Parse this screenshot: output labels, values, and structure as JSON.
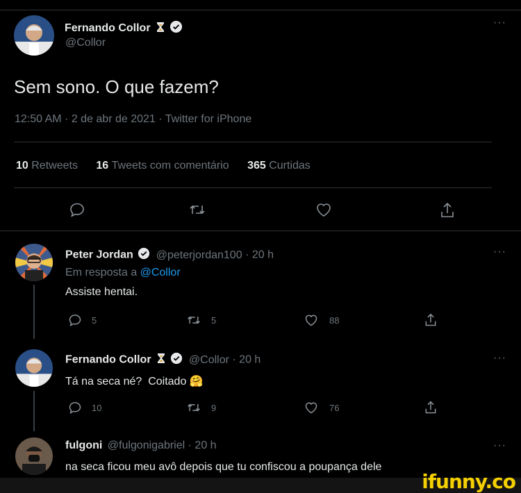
{
  "main_tweet": {
    "author_name": "Fernando Collor",
    "author_handle": "@Collor",
    "text": "Sem sono. O que fazem?",
    "meta": "12:50 AM · 2 de abr de 2021 · Twitter for iPhone",
    "stats": [
      {
        "num": "10",
        "label": "Retweets"
      },
      {
        "num": "16",
        "label": "Tweets com comentário"
      },
      {
        "num": "365",
        "label": "Curtidas"
      }
    ],
    "more_icon": "ellipsis-icon"
  },
  "replies": [
    {
      "author_name": "Peter Jordan",
      "author_handle": "@peterjordan100",
      "time": "· 20 h",
      "reply_prefix": "Em resposta a",
      "reply_to": "@Collor",
      "text": "Assiste hentai.",
      "reply_count": "5",
      "retweet_count": "5",
      "like_count": "88"
    },
    {
      "author_name": "Fernando Collor",
      "author_handle": "@Collor",
      "time": "· 20 h",
      "text": "Tá na seca né?  Coitado",
      "emoji": "🤗",
      "reply_count": "10",
      "retweet_count": "9",
      "like_count": "76"
    },
    {
      "author_name": "fulgoni",
      "author_handle": "@fulgonigabriel",
      "time": "· 20 h",
      "text": "na seca ficou meu avô depois que tu confiscou a poupança dele"
    }
  ],
  "watermark": "ifunny.co",
  "colors": {
    "background": "#000000",
    "text": "#e7e9ea",
    "muted": "#6e767d",
    "link": "#1d9bf0",
    "divider": "#2f3336",
    "watermark": "#f5d000"
  }
}
